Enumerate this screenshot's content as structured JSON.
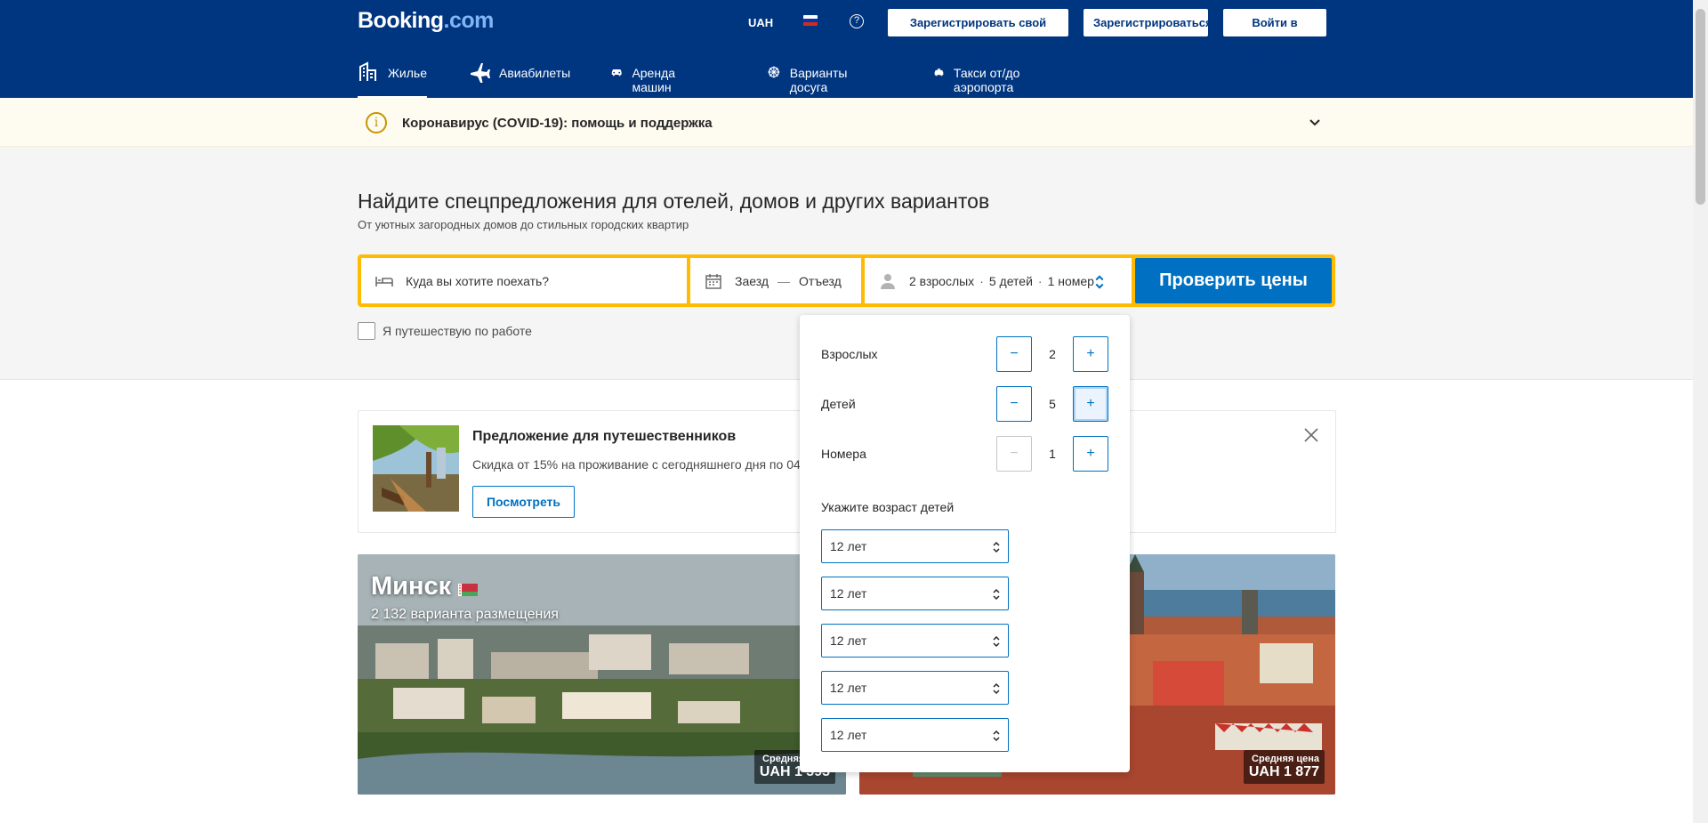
{
  "header": {
    "logo_main": "Booking",
    "logo_dot": ".com",
    "currency": "UAH",
    "help_icon": "help-circle-icon",
    "list_property": "Зарегистрировать свой объект",
    "register": "Зарегистрироваться",
    "login": "Войти в аккаунт"
  },
  "nav": [
    {
      "label": "Жилье",
      "icon": "bed-building-icon",
      "active": true
    },
    {
      "label": "Авиабилеты",
      "icon": "airplane-icon"
    },
    {
      "label": "Аренда машин",
      "icon": "car-icon"
    },
    {
      "label": "Варианты досуга",
      "icon": "attractions-icon"
    },
    {
      "label": "Такси от/до аэропорта",
      "icon": "taxi-icon"
    }
  ],
  "covid": {
    "text": "Коронавирус (COVID-19): помощь и поддержка"
  },
  "hero": {
    "title": "Найдите спецпредложения для отелей, домов и других вариантов",
    "subtitle": "От уютных загородных домов до стильных городских квартир"
  },
  "search": {
    "destination_placeholder": "Куда вы хотите поехать?",
    "checkin": "Заезд",
    "date_separator": "—",
    "checkout": "Отъезд",
    "adults_summary": "2 взрослых",
    "children_summary": "5 детей",
    "rooms_summary": "1 номер",
    "dot": "·",
    "submit": "Проверить цены",
    "business_travel": "Я путешествую по работе"
  },
  "offer": {
    "title": "Предложение для путешественников",
    "text": "Скидка от 15% на проживание с сегодняшнего дня по 04.",
    "button": "Посмотреть"
  },
  "cities": [
    {
      "name": "Минск",
      "count": "2 132 варианта размещения",
      "price_label": "Средняя цена",
      "price": "UAH 1 393"
    },
    {
      "name": "",
      "count": "",
      "price_label": "Средняя цена",
      "price": "UAH 1 877"
    }
  ],
  "guests_popup": {
    "adults_label": "Взрослых",
    "adults": "2",
    "children_label": "Детей",
    "children": "5",
    "rooms_label": "Номера",
    "rooms": "1",
    "minus": "−",
    "plus": "+",
    "ages_title": "Укажите возраст детей",
    "child_ages": [
      "12 лет",
      "12 лет",
      "12 лет",
      "12 лет",
      "12 лет"
    ]
  },
  "colors": {
    "brand_dark": "#003580",
    "primary": "#0071c2",
    "search_border": "#febb02"
  }
}
